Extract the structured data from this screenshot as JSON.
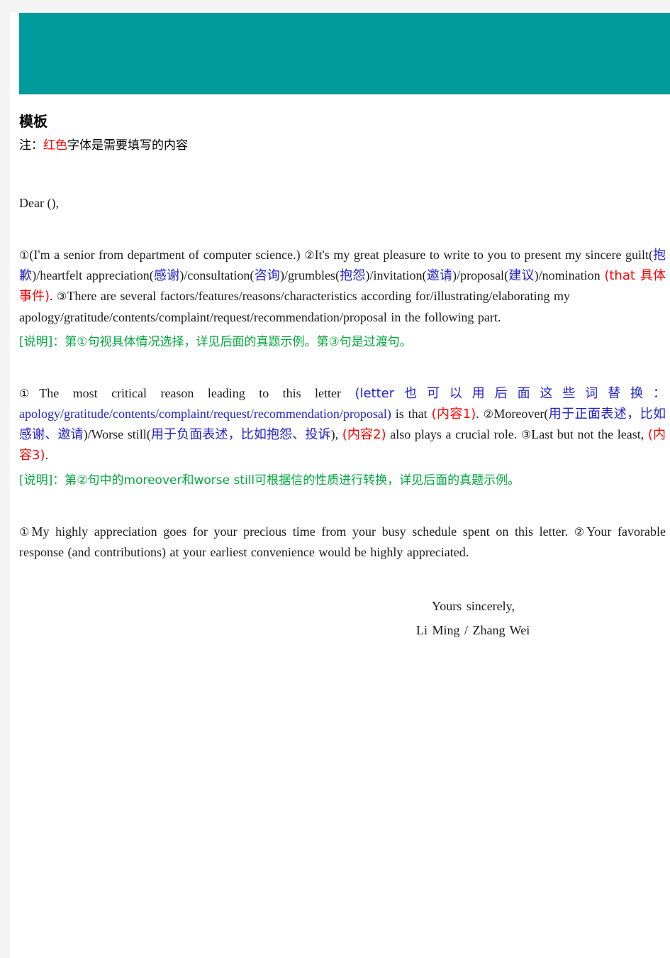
{
  "document": {
    "header_band_color": "#019a9d",
    "page_background": "#ffffff",
    "canvas_background": "#f4f4f4",
    "title": "模板",
    "note": {
      "prefix": "注：",
      "red_word": "红色",
      "suffix": "字体是需要填写的内容"
    },
    "salutation": "Dear  (),",
    "paragraph1": {
      "m1": "①",
      "t1": "(I'm a senior from department of computer science.) ",
      "m2": "②",
      "t2": "It's my great pleasure to write to you to present my sincere guilt(",
      "cn1": "抱歉",
      "t3": ")/heartfelt appreciation(",
      "cn2": "感谢",
      "t4": ")/consultation(",
      "cn3": "咨询",
      "t5": ")/grumbles(",
      "cn4": "抱怨",
      "t6": ")/invitation(",
      "cn5": "邀请",
      "t7": ")/proposal(",
      "cn6": "建议",
      "t8": ")/nomination ",
      "red1": "(that 具体事件)",
      "t9": ". ",
      "m3": "③",
      "t10": "There are several factors/features/reasons/characteristics according for/illustrating/elaborating my",
      "t11": "apology/gratitude/contents/complaint/request/recommendation/proposal in the following part."
    },
    "explain1": {
      "label": "[说明]：",
      "text": "第①句视具体情况选择，详见后面的真题示例。第③句是过渡句。"
    },
    "paragraph2": {
      "m1": "①",
      "t1": "The most critical reason leading to this letter ",
      "blue1": "(letter也可以用后面这些词替换：",
      "blue2": "apology/gratitude/contents/complaint/request/recommendation/proposal)",
      "t2": " is that ",
      "red1": "(内容1)",
      "t3": ". ",
      "m2": "②",
      "t4": "Moreover(",
      "blue3": "用于正面表述，比如感谢、邀请",
      "t5": ")/Worse still(",
      "blue4": "用于负面表述，比如抱怨、投诉",
      "t6": "), ",
      "red2": "(内容2)",
      "t7": " also plays a crucial role. ",
      "m3": "③",
      "t8": "Last but not the least, ",
      "red3": "(内容3)",
      "t9": "."
    },
    "explain2": {
      "label": "[说明]：",
      "text": "第②句中的moreover和worse still可根据信的性质进行转换，详见后面的真题示例。"
    },
    "paragraph3": {
      "m1": "①",
      "t1": "My highly appreciation goes for your precious time from your busy schedule spent on this letter. ",
      "m2": "②",
      "t2": "Your favorable response (and contributions) at your earliest convenience would be highly appreciated."
    },
    "closing": {
      "line1": "Yours  sincerely,",
      "line2": "Li Ming / Zhang Wei"
    }
  }
}
